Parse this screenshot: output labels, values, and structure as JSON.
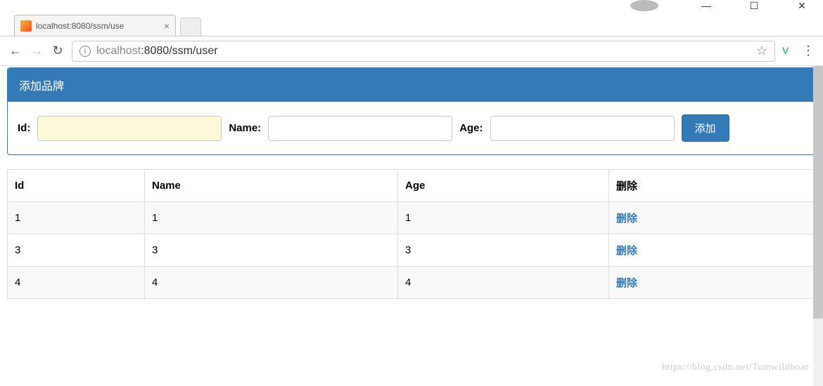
{
  "window": {
    "minimize": "—",
    "maximize": "☐",
    "close": "✕"
  },
  "tab": {
    "title": "localhost:8080/ssm/use",
    "close": "×"
  },
  "address": {
    "info": "i",
    "host": "localhost",
    "port_path": ":8080/ssm/user",
    "star": "☆",
    "vue": "V",
    "menu": "⋮"
  },
  "nav": {
    "back": "←",
    "forward": "→",
    "reload": "↻"
  },
  "panel": {
    "title": "添加品牌",
    "labels": {
      "id": "Id:",
      "name": "Name:",
      "age": "Age:"
    },
    "inputs": {
      "id": "",
      "name": "",
      "age": ""
    },
    "add_button": "添加"
  },
  "table": {
    "headers": {
      "id": "Id",
      "name": "Name",
      "age": "Age",
      "delete": "删除"
    },
    "rows": [
      {
        "id": "1",
        "name": "1",
        "age": "1",
        "delete": "删除"
      },
      {
        "id": "3",
        "name": "3",
        "age": "3",
        "delete": "删除"
      },
      {
        "id": "4",
        "name": "4",
        "age": "4",
        "delete": "删除"
      }
    ]
  },
  "watermark": "https://blog.csdn.net/Tomwildboar"
}
